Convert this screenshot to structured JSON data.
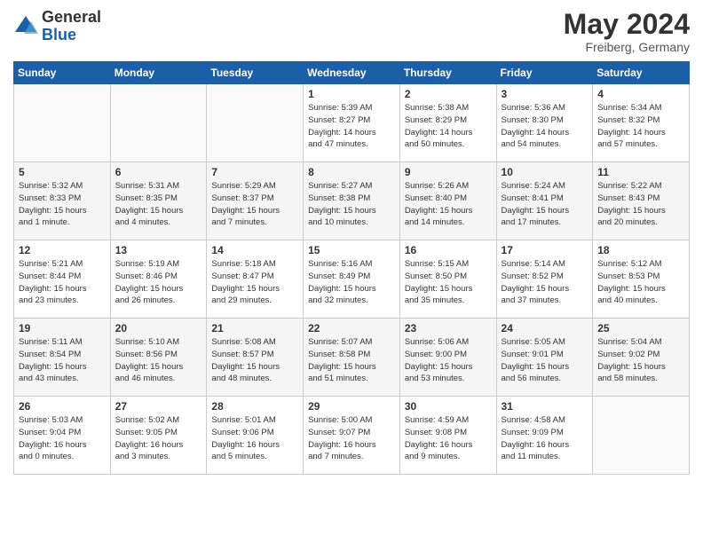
{
  "logo": {
    "general": "General",
    "blue": "Blue"
  },
  "title": "May 2024",
  "location": "Freiberg, Germany",
  "days_header": [
    "Sunday",
    "Monday",
    "Tuesday",
    "Wednesday",
    "Thursday",
    "Friday",
    "Saturday"
  ],
  "weeks": [
    [
      {
        "day": "",
        "info": ""
      },
      {
        "day": "",
        "info": ""
      },
      {
        "day": "",
        "info": ""
      },
      {
        "day": "1",
        "info": "Sunrise: 5:39 AM\nSunset: 8:27 PM\nDaylight: 14 hours\nand 47 minutes."
      },
      {
        "day": "2",
        "info": "Sunrise: 5:38 AM\nSunset: 8:29 PM\nDaylight: 14 hours\nand 50 minutes."
      },
      {
        "day": "3",
        "info": "Sunrise: 5:36 AM\nSunset: 8:30 PM\nDaylight: 14 hours\nand 54 minutes."
      },
      {
        "day": "4",
        "info": "Sunrise: 5:34 AM\nSunset: 8:32 PM\nDaylight: 14 hours\nand 57 minutes."
      }
    ],
    [
      {
        "day": "5",
        "info": "Sunrise: 5:32 AM\nSunset: 8:33 PM\nDaylight: 15 hours\nand 1 minute."
      },
      {
        "day": "6",
        "info": "Sunrise: 5:31 AM\nSunset: 8:35 PM\nDaylight: 15 hours\nand 4 minutes."
      },
      {
        "day": "7",
        "info": "Sunrise: 5:29 AM\nSunset: 8:37 PM\nDaylight: 15 hours\nand 7 minutes."
      },
      {
        "day": "8",
        "info": "Sunrise: 5:27 AM\nSunset: 8:38 PM\nDaylight: 15 hours\nand 10 minutes."
      },
      {
        "day": "9",
        "info": "Sunrise: 5:26 AM\nSunset: 8:40 PM\nDaylight: 15 hours\nand 14 minutes."
      },
      {
        "day": "10",
        "info": "Sunrise: 5:24 AM\nSunset: 8:41 PM\nDaylight: 15 hours\nand 17 minutes."
      },
      {
        "day": "11",
        "info": "Sunrise: 5:22 AM\nSunset: 8:43 PM\nDaylight: 15 hours\nand 20 minutes."
      }
    ],
    [
      {
        "day": "12",
        "info": "Sunrise: 5:21 AM\nSunset: 8:44 PM\nDaylight: 15 hours\nand 23 minutes."
      },
      {
        "day": "13",
        "info": "Sunrise: 5:19 AM\nSunset: 8:46 PM\nDaylight: 15 hours\nand 26 minutes."
      },
      {
        "day": "14",
        "info": "Sunrise: 5:18 AM\nSunset: 8:47 PM\nDaylight: 15 hours\nand 29 minutes."
      },
      {
        "day": "15",
        "info": "Sunrise: 5:16 AM\nSunset: 8:49 PM\nDaylight: 15 hours\nand 32 minutes."
      },
      {
        "day": "16",
        "info": "Sunrise: 5:15 AM\nSunset: 8:50 PM\nDaylight: 15 hours\nand 35 minutes."
      },
      {
        "day": "17",
        "info": "Sunrise: 5:14 AM\nSunset: 8:52 PM\nDaylight: 15 hours\nand 37 minutes."
      },
      {
        "day": "18",
        "info": "Sunrise: 5:12 AM\nSunset: 8:53 PM\nDaylight: 15 hours\nand 40 minutes."
      }
    ],
    [
      {
        "day": "19",
        "info": "Sunrise: 5:11 AM\nSunset: 8:54 PM\nDaylight: 15 hours\nand 43 minutes."
      },
      {
        "day": "20",
        "info": "Sunrise: 5:10 AM\nSunset: 8:56 PM\nDaylight: 15 hours\nand 46 minutes."
      },
      {
        "day": "21",
        "info": "Sunrise: 5:08 AM\nSunset: 8:57 PM\nDaylight: 15 hours\nand 48 minutes."
      },
      {
        "day": "22",
        "info": "Sunrise: 5:07 AM\nSunset: 8:58 PM\nDaylight: 15 hours\nand 51 minutes."
      },
      {
        "day": "23",
        "info": "Sunrise: 5:06 AM\nSunset: 9:00 PM\nDaylight: 15 hours\nand 53 minutes."
      },
      {
        "day": "24",
        "info": "Sunrise: 5:05 AM\nSunset: 9:01 PM\nDaylight: 15 hours\nand 56 minutes."
      },
      {
        "day": "25",
        "info": "Sunrise: 5:04 AM\nSunset: 9:02 PM\nDaylight: 15 hours\nand 58 minutes."
      }
    ],
    [
      {
        "day": "26",
        "info": "Sunrise: 5:03 AM\nSunset: 9:04 PM\nDaylight: 16 hours\nand 0 minutes."
      },
      {
        "day": "27",
        "info": "Sunrise: 5:02 AM\nSunset: 9:05 PM\nDaylight: 16 hours\nand 3 minutes."
      },
      {
        "day": "28",
        "info": "Sunrise: 5:01 AM\nSunset: 9:06 PM\nDaylight: 16 hours\nand 5 minutes."
      },
      {
        "day": "29",
        "info": "Sunrise: 5:00 AM\nSunset: 9:07 PM\nDaylight: 16 hours\nand 7 minutes."
      },
      {
        "day": "30",
        "info": "Sunrise: 4:59 AM\nSunset: 9:08 PM\nDaylight: 16 hours\nand 9 minutes."
      },
      {
        "day": "31",
        "info": "Sunrise: 4:58 AM\nSunset: 9:09 PM\nDaylight: 16 hours\nand 11 minutes."
      },
      {
        "day": "",
        "info": ""
      }
    ]
  ]
}
